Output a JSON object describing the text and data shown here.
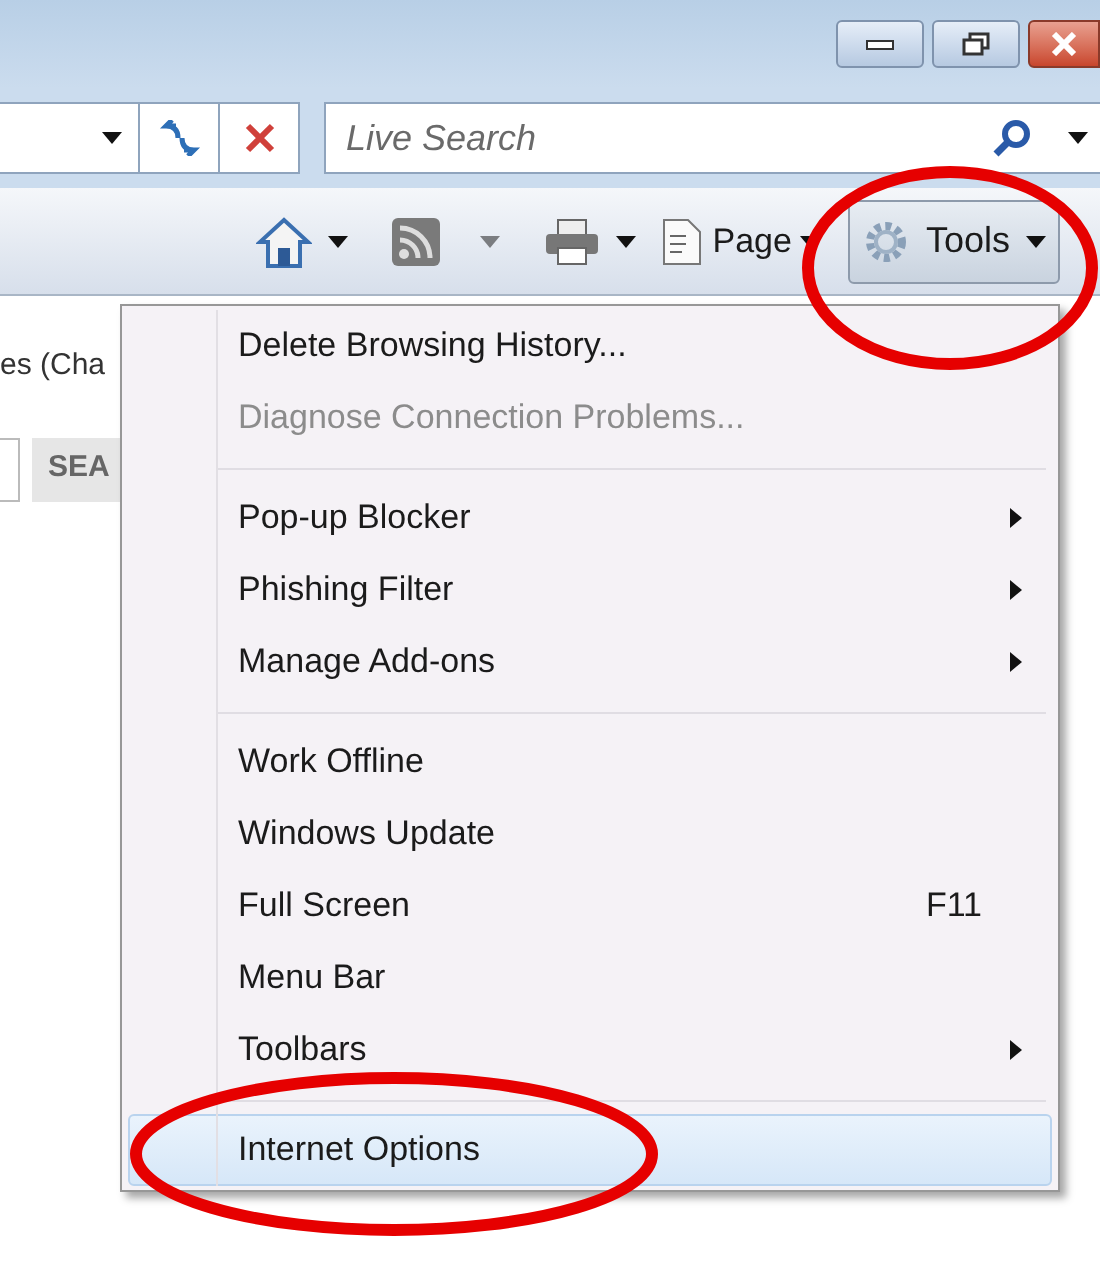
{
  "search": {
    "placeholder": "Live Search"
  },
  "command_bar": {
    "page_label": "Page",
    "tools_label": "Tools",
    "tools_selected": true
  },
  "page": {
    "heading_fragment": "es (Cha",
    "button_fragment": "SEA"
  },
  "menu": [
    {
      "kind": "item",
      "label": "Delete Browsing History...",
      "disabled": false,
      "submenu": false,
      "selected": false
    },
    {
      "kind": "item",
      "label": "Diagnose Connection Problems...",
      "disabled": true,
      "submenu": false,
      "selected": false
    },
    {
      "kind": "separator"
    },
    {
      "kind": "item",
      "label": "Pop-up Blocker",
      "disabled": false,
      "submenu": true,
      "selected": false
    },
    {
      "kind": "item",
      "label": "Phishing Filter",
      "disabled": false,
      "submenu": true,
      "selected": false
    },
    {
      "kind": "item",
      "label": "Manage Add-ons",
      "disabled": false,
      "submenu": true,
      "selected": false
    },
    {
      "kind": "separator"
    },
    {
      "kind": "item",
      "label": "Work Offline",
      "disabled": false,
      "submenu": false,
      "selected": false
    },
    {
      "kind": "item",
      "label": "Windows Update",
      "disabled": false,
      "submenu": false,
      "selected": false
    },
    {
      "kind": "item",
      "label": "Full Screen",
      "shortcut": "F11",
      "disabled": false,
      "submenu": false,
      "selected": false
    },
    {
      "kind": "item",
      "label": "Menu Bar",
      "disabled": false,
      "submenu": false,
      "selected": false
    },
    {
      "kind": "item",
      "label": "Toolbars",
      "disabled": false,
      "submenu": true,
      "selected": false
    },
    {
      "kind": "separator"
    },
    {
      "kind": "item",
      "label": "Internet Options",
      "disabled": false,
      "submenu": false,
      "selected": true
    }
  ]
}
